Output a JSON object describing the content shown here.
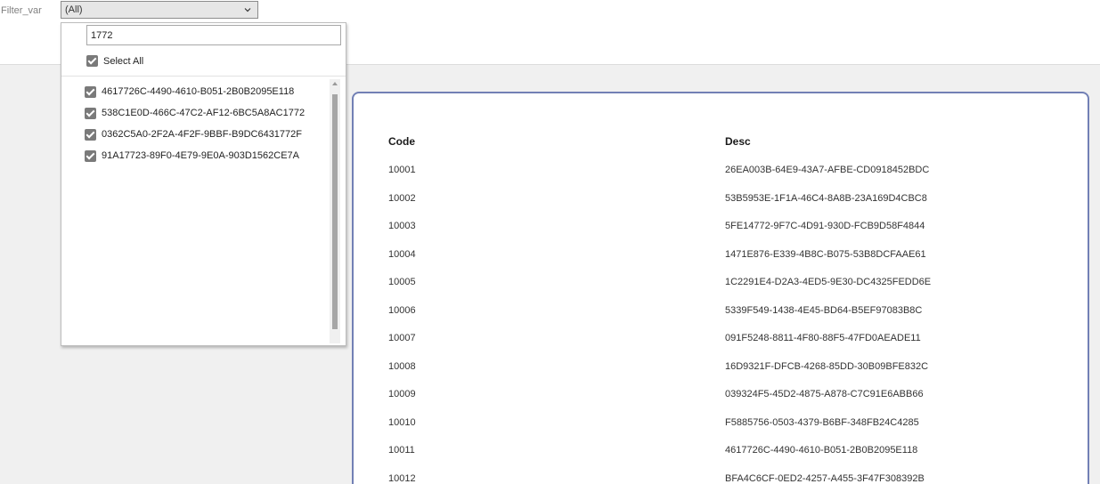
{
  "filter": {
    "label": "Filter_var",
    "selected": "(All)",
    "search_value": "1772",
    "select_all_label": "Select All",
    "items": [
      {
        "label": "4617726C-4490-4610-B051-2B0B2095E118",
        "checked": true
      },
      {
        "label": "538C1E0D-466C-47C2-AF12-6BC5A8AC1772",
        "checked": true
      },
      {
        "label": "0362C5A0-2F2A-4F2F-9BBF-B9DC6431772F",
        "checked": true
      },
      {
        "label": "91A17723-89F0-4E79-9E0A-903D1562CE7A",
        "checked": true
      }
    ]
  },
  "table": {
    "columns": [
      "Code",
      "Desc"
    ],
    "rows": [
      [
        "10001",
        "26EA003B-64E9-43A7-AFBE-CD0918452BDC"
      ],
      [
        "10002",
        "53B5953E-1F1A-46C4-8A8B-23A169D4CBC8"
      ],
      [
        "10003",
        "5FE14772-9F7C-4D91-930D-FCB9D58F4844"
      ],
      [
        "10004",
        "1471E876-E339-4B8C-B075-53B8DCFAAE61"
      ],
      [
        "10005",
        "1C2291E4-D2A3-4ED5-9E30-DC4325FEDD6E"
      ],
      [
        "10006",
        "5339F549-1438-4E45-BD64-B5EF97083B8C"
      ],
      [
        "10007",
        "091F5248-8811-4F80-88F5-47FD0AEADE11"
      ],
      [
        "10008",
        "16D9321F-DFCB-4268-85DD-30B09BFE832C"
      ],
      [
        "10009",
        "039324F5-45D2-4875-A878-C7C91E6ABB66"
      ],
      [
        "10010",
        "F5885756-0503-4379-B6BF-348FB24C4285"
      ],
      [
        "10011",
        "4617726C-4490-4610-B051-2B0B2095E118"
      ],
      [
        "10012",
        "BFA4C6CF-0ED2-4257-A455-3F47F308392B"
      ]
    ]
  },
  "colors": {
    "card_border": "#7280b5",
    "checkbox": "#7a7a7a"
  }
}
